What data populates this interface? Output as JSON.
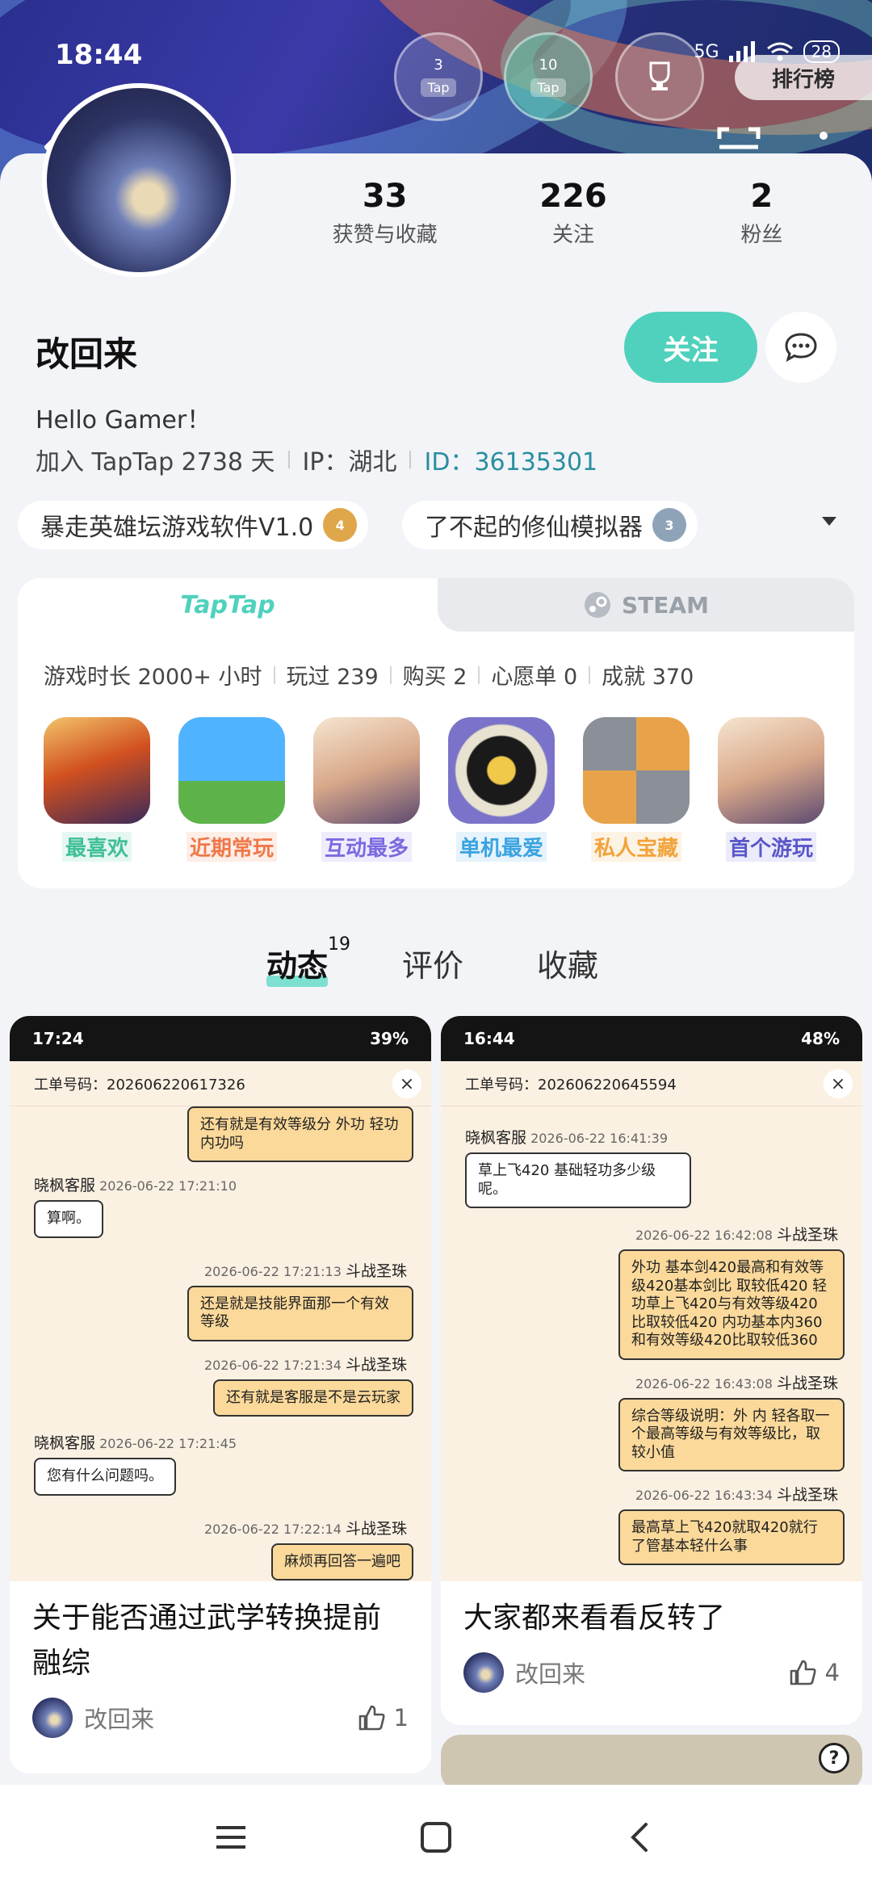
{
  "status_bar": {
    "time": "18:44",
    "battery": "28",
    "network": "5G"
  },
  "header": {
    "medals": [
      {
        "level": "3",
        "badge": "Tap"
      },
      {
        "level": "10",
        "badge": "Tap"
      },
      {
        "level": "",
        "badge": ""
      }
    ],
    "ranking_label": "排行榜"
  },
  "profile": {
    "stats": [
      {
        "value": "33",
        "label": "获赞与收藏"
      },
      {
        "value": "226",
        "label": "关注"
      },
      {
        "value": "2",
        "label": "粉丝"
      }
    ],
    "nickname": "改回来",
    "follow_label": "关注",
    "bio": "Hello Gamer！",
    "joined": "加入 TapTap 2738 天",
    "ip": "IP：湖北",
    "id_label": "ID：",
    "id_value": "36135301"
  },
  "game_tags": [
    {
      "name": "暴走英雄坛游戏软件V1.0",
      "level": "4"
    },
    {
      "name": "了不起的修仙模拟器",
      "level": "3"
    }
  ],
  "game_card": {
    "tab_taptap": "TapTap",
    "tab_steam": "STEAM",
    "stats": [
      "游戏时长 2000+ 小时",
      "玩过 239",
      "购买 2",
      "心愿单 0",
      "成就 370"
    ],
    "games": [
      {
        "label": "最喜欢",
        "color": "#3fbf9a",
        "bg": "#e6f7f2"
      },
      {
        "label": "近期常玩",
        "color": "#f0784a",
        "bg": "#fdeee7"
      },
      {
        "label": "互动最多",
        "color": "#7a6ae0",
        "bg": "#efecfd"
      },
      {
        "label": "单机最爱",
        "color": "#3aa3e0",
        "bg": "#e6f3fc"
      },
      {
        "label": "私人宝藏",
        "color": "#f2a33a",
        "bg": "#fdf3e4"
      },
      {
        "label": "首个游玩",
        "color": "#5a58c8",
        "bg": "#ecebfb"
      }
    ]
  },
  "content_tabs": [
    {
      "label": "动态",
      "count": "19"
    },
    {
      "label": "评价"
    },
    {
      "label": "收藏"
    }
  ],
  "posts": [
    {
      "screenshot": {
        "time": "17:24",
        "battery": "39%",
        "ticket": "工单号码：202606220617326",
        "messages": [
          {
            "side": "right",
            "meta": "",
            "name": "",
            "text": "还有就是有效等级分 外功 轻功 内功吗"
          },
          {
            "side": "left",
            "meta": "2026-06-22 17:21:10",
            "name": "晓枫客服",
            "text": "算啊。"
          },
          {
            "side": "right",
            "meta": "2026-06-22 17:21:13",
            "name": "斗战圣珠",
            "text": "还是就是技能界面那一个有效等级"
          },
          {
            "side": "right",
            "meta": "2026-06-22 17:21:34",
            "name": "斗战圣珠",
            "text": "还有就是客服是不是云玩家"
          },
          {
            "side": "left",
            "meta": "2026-06-22 17:21:45",
            "name": "晓枫客服",
            "text": "您有什么问题吗。"
          },
          {
            "side": "right",
            "meta": "2026-06-22 17:22:14",
            "name": "斗战圣珠",
            "text": "麻烦再回答一遍吧"
          }
        ]
      },
      "title": "关于能否通过武学转换提前融综",
      "author": "改回来",
      "likes": "1"
    },
    {
      "screenshot": {
        "time": "16:44",
        "battery": "48%",
        "ticket": "工单号码：202606220645594",
        "messages": [
          {
            "side": "left",
            "meta": "2026-06-22 16:41:39",
            "name": "晓枫客服",
            "text": "草上飞420 基础轻功多少级呢。"
          },
          {
            "side": "right",
            "meta": "2026-06-22 16:42:08",
            "name": "斗战圣珠",
            "text": "外功 基本剑420最高和有效等级420基本剑比 取较低420 轻功草上飞420与有效等级420比取较低420 内功基本内360和有效等级420比取较低360"
          },
          {
            "side": "right",
            "meta": "2026-06-22 16:43:08",
            "name": "斗战圣珠",
            "text": "综合等级说明：外 内 轻各取一个最高等级与有效等级比，取较小值"
          },
          {
            "side": "right",
            "meta": "2026-06-22 16:43:34",
            "name": "斗战圣珠",
            "text": "最高草上飞420就取420就行了管基本轻什么事"
          }
        ]
      },
      "title": "大家都来看看反转了",
      "author": "改回来",
      "likes": "4"
    }
  ],
  "colors": {
    "accent": "#4fd1bd",
    "id_link": "#2a8ea0",
    "background": "#f2f4f7"
  }
}
